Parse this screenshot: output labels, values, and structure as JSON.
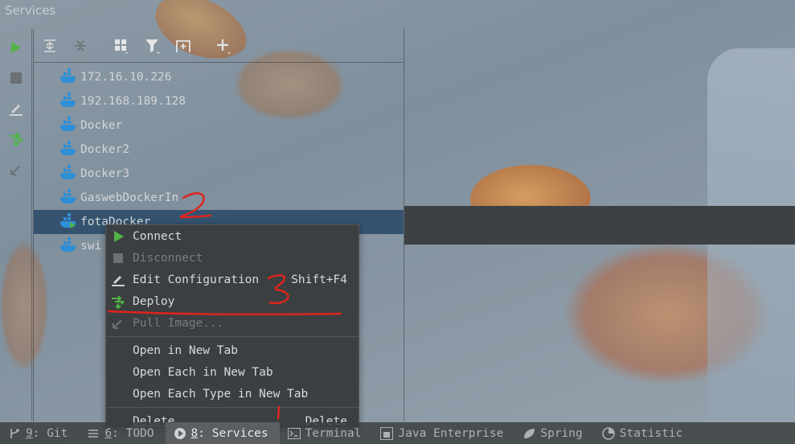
{
  "window": {
    "title": "Services"
  },
  "left_toolbar": [
    {
      "icon": "run-icon"
    },
    {
      "icon": "stop-icon"
    },
    {
      "icon": "edit-icon"
    },
    {
      "icon": "deploy-icon"
    },
    {
      "icon": "pull-image-icon"
    }
  ],
  "top_toolbar": [
    {
      "icon": "expand-all-icon"
    },
    {
      "icon": "collapse-all-icon"
    },
    {
      "icon": "group-by-icon"
    },
    {
      "icon": "filter-icon"
    },
    {
      "icon": "new-tab-icon"
    },
    {
      "icon": "add-icon"
    }
  ],
  "tree": {
    "items": [
      {
        "label": "172.16.10.226"
      },
      {
        "label": "192.168.189.128"
      },
      {
        "label": "Docker"
      },
      {
        "label": "Docker2"
      },
      {
        "label": "Docker3"
      },
      {
        "label": "GaswebDockerIn"
      },
      {
        "label": "fotaDocker",
        "selected": true
      },
      {
        "label": "swi"
      }
    ]
  },
  "context_menu": {
    "items": [
      {
        "label": "Connect",
        "icon": "run-icon",
        "shortcut": "",
        "disabled": false
      },
      {
        "label": "Disconnect",
        "icon": "stop-icon",
        "shortcut": "",
        "disabled": true
      },
      {
        "label": "Edit Configuration",
        "icon": "edit-icon",
        "shortcut": "Shift+F4",
        "disabled": false
      },
      {
        "label": "Deploy",
        "icon": "deploy-icon",
        "shortcut": "",
        "disabled": false
      },
      {
        "label": "Pull Image...",
        "icon": "pull-image-icon",
        "shortcut": "",
        "disabled": true
      }
    ],
    "items2": [
      {
        "label": "Open in New Tab"
      },
      {
        "label": "Open Each in New Tab"
      },
      {
        "label": "Open Each Type in New Tab"
      }
    ],
    "delete": {
      "label": "Delete...",
      "shortcut": "Delete"
    }
  },
  "annotations": {
    "one": "1",
    "two": "2",
    "three": "3"
  },
  "bottom_tabs": [
    {
      "num": "9",
      "label": ": Git",
      "icon": "git-icon",
      "active": false
    },
    {
      "num": "6",
      "label": ": TODO",
      "icon": "todo-icon",
      "active": false
    },
    {
      "num": "8",
      "label": ": Services",
      "icon": "services-icon",
      "active": true
    },
    {
      "num": "",
      "label": "Terminal",
      "icon": "terminal-icon",
      "active": false
    },
    {
      "num": "",
      "label": "Java Enterprise",
      "icon": "java-enterprise-icon",
      "active": false
    },
    {
      "num": "",
      "label": "Spring",
      "icon": "spring-icon",
      "active": false
    },
    {
      "num": "",
      "label": "Statistic",
      "icon": "statistic-icon",
      "active": false
    }
  ],
  "colors": {
    "accent_selection": "#35536f",
    "run_green": "#4fb446",
    "docker_blue": "#2f8fd6",
    "annotation_red": "#e0241b"
  }
}
